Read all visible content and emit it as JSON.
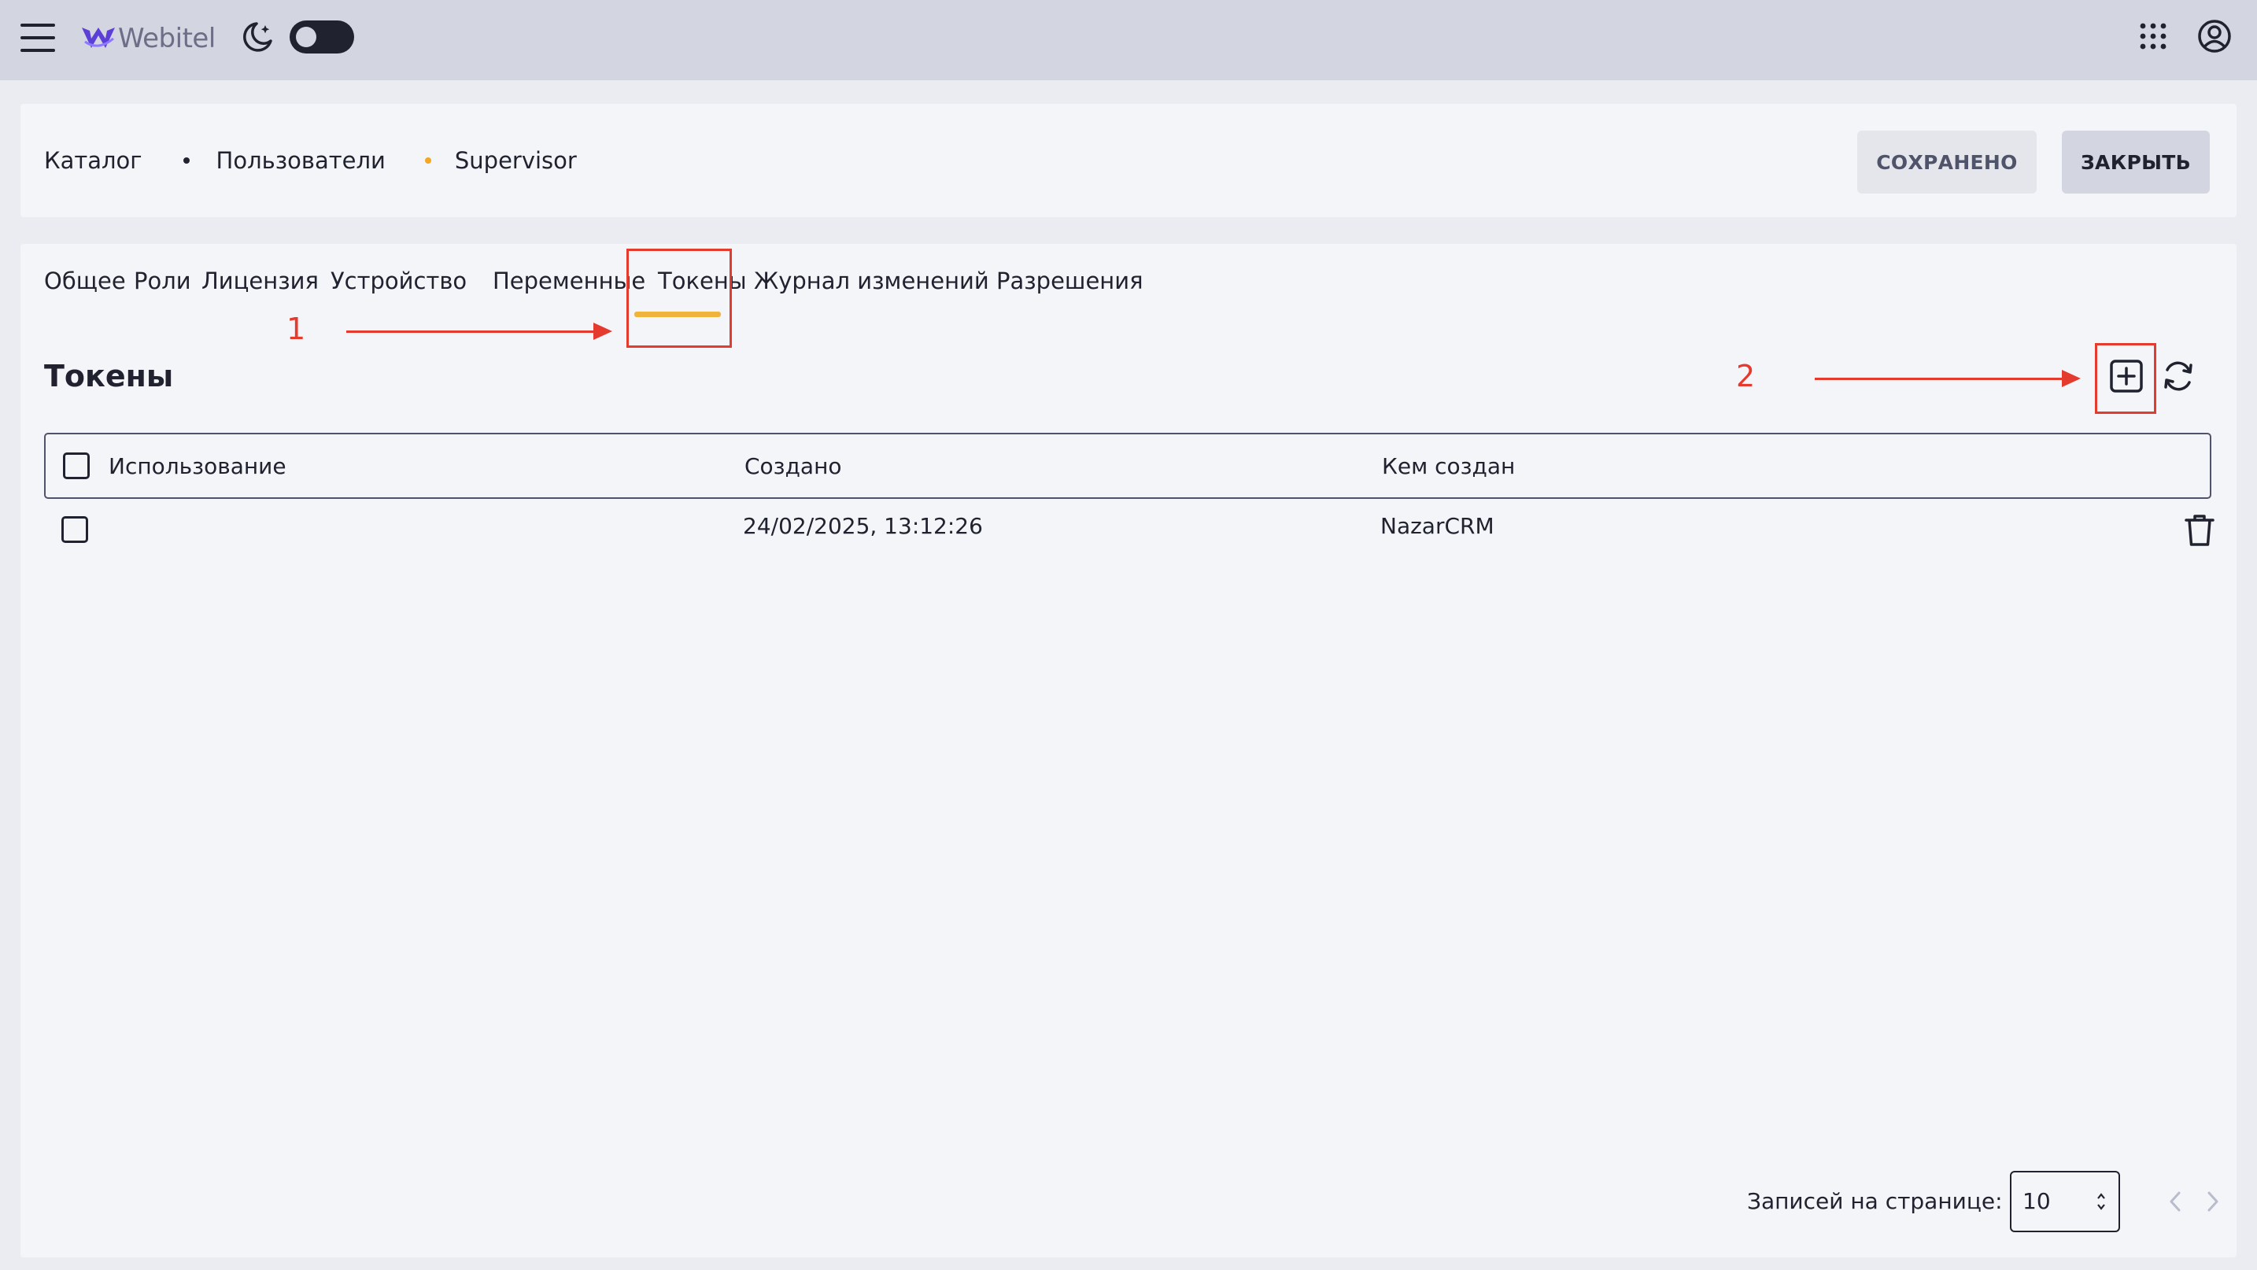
{
  "app": {
    "logo_text": "Webitel",
    "brand_color": "#5b3fd6",
    "accent_color": "#f0b33b",
    "theme_toggle_dark": true
  },
  "topbar": {
    "icons": [
      "menu-icon",
      "webitel-logo",
      "moon-icon",
      "apps-grid-icon",
      "user-icon"
    ]
  },
  "breadcrumb": {
    "items": [
      "Каталог",
      "Пользователи",
      "Supervisor"
    ]
  },
  "actions": {
    "saved_label": "СОХРАНЕНО",
    "close_label": "ЗАКРЫТЬ"
  },
  "tabs": {
    "items": [
      {
        "label": "Общее"
      },
      {
        "label": "Роли"
      },
      {
        "label": "Лицензия"
      },
      {
        "label": "Устройство"
      },
      {
        "label": "Переменные"
      },
      {
        "label": "Токены",
        "active": true
      },
      {
        "label": "Журнал изменений"
      },
      {
        "label": "Разрешения"
      }
    ]
  },
  "section": {
    "title": "Токены",
    "icons": [
      "add-icon",
      "refresh-icon"
    ]
  },
  "table": {
    "columns": [
      "Использование",
      "Создано",
      "Кем создан"
    ],
    "rows": [
      {
        "usage": "",
        "created": "24/02/2025, 13:12:26",
        "created_by": "NazarCRM",
        "icon": "trash-icon"
      }
    ]
  },
  "pagination": {
    "label": "Записей на странице:",
    "per_page": "10"
  },
  "annotations": {
    "color": "#e53a2e",
    "marker_1": "1",
    "marker_2": "2"
  }
}
